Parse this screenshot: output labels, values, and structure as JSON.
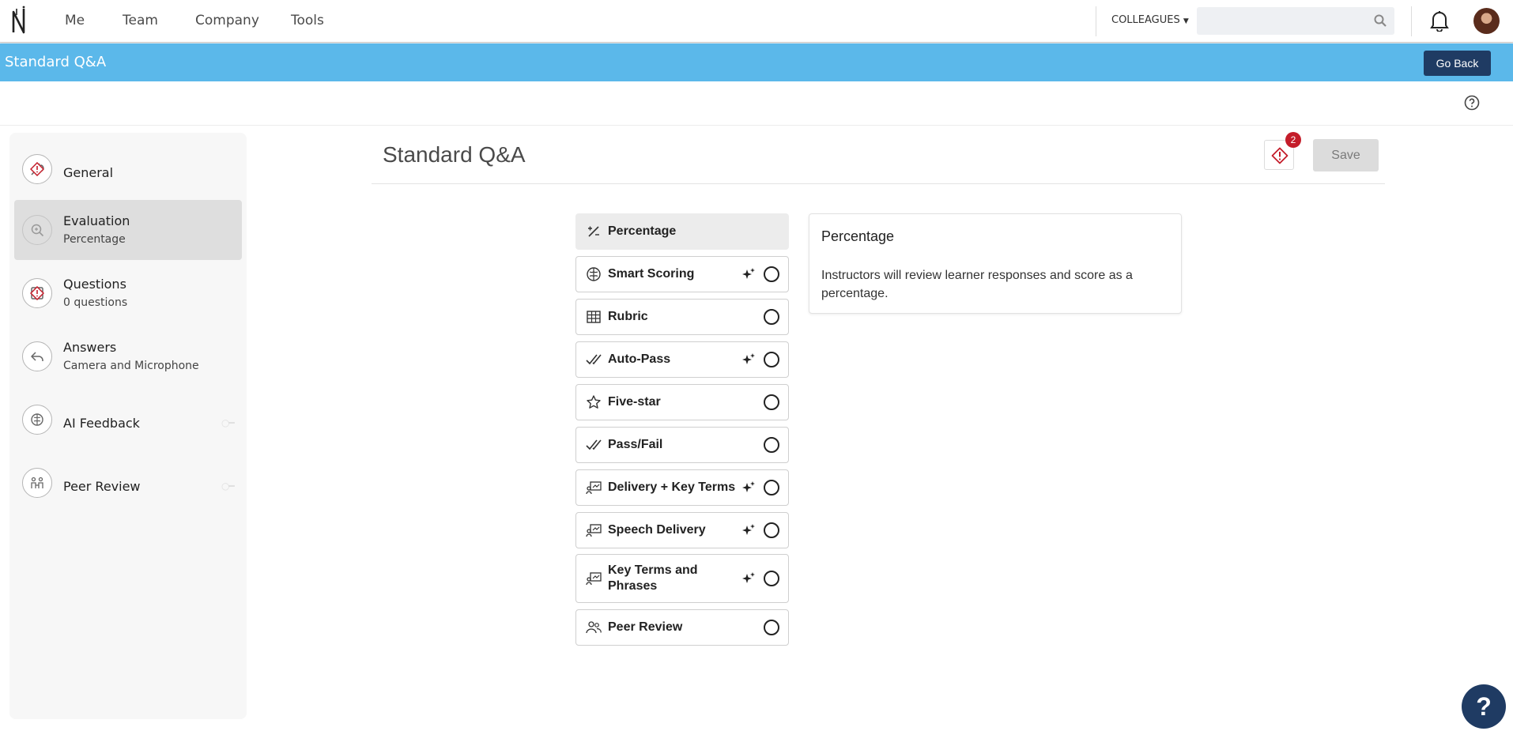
{
  "nav": {
    "links": [
      "Me",
      "Team",
      "Company",
      "Tools"
    ],
    "colleagues_label": "COLLEAGUES",
    "search_placeholder": ""
  },
  "banner": {
    "title": "Standard Q&A",
    "go_back_label": "Go Back"
  },
  "sidebar": {
    "items": [
      {
        "title": "General",
        "subtitle": "",
        "icon": "wrench-icon",
        "warning": true
      },
      {
        "title": "Evaluation",
        "subtitle": "Percentage",
        "icon": "magnify-icon",
        "warning": false,
        "active": true
      },
      {
        "title": "Questions",
        "subtitle": "0 questions",
        "icon": "question-doc-icon",
        "warning": true
      },
      {
        "title": "Answers",
        "subtitle": "Camera and Microphone",
        "icon": "reply-icon",
        "warning": false
      },
      {
        "title": "AI Feedback",
        "subtitle": "",
        "icon": "brain-icon",
        "warning": false
      },
      {
        "title": "Peer Review",
        "subtitle": "",
        "icon": "peers-icon",
        "warning": false
      }
    ]
  },
  "main": {
    "title": "Standard Q&A",
    "issues_count": "2",
    "save_label": "Save"
  },
  "options": [
    {
      "label": "Percentage",
      "icon": "percent-icon",
      "ai": false,
      "radio": false,
      "selected": true
    },
    {
      "label": "Smart Scoring",
      "icon": "brain-icon",
      "ai": true,
      "radio": true
    },
    {
      "label": "Rubric",
      "icon": "grid-icon",
      "ai": false,
      "radio": true
    },
    {
      "label": "Auto-Pass",
      "icon": "double-check-icon",
      "ai": true,
      "radio": true
    },
    {
      "label": "Five-star",
      "icon": "star-icon",
      "ai": false,
      "radio": true
    },
    {
      "label": "Pass/Fail",
      "icon": "double-check-icon",
      "ai": false,
      "radio": true
    },
    {
      "label": "Delivery + Key Terms",
      "icon": "presentation-icon",
      "ai": true,
      "radio": true
    },
    {
      "label": "Speech Delivery",
      "icon": "presentation-icon",
      "ai": true,
      "radio": true
    },
    {
      "label": "Key Terms and Phrases",
      "icon": "presentation-icon",
      "ai": true,
      "radio": true
    },
    {
      "label": "Peer Review",
      "icon": "people-icon",
      "ai": false,
      "radio": true
    }
  ],
  "description": {
    "title": "Percentage",
    "text": "Instructors will review learner responses and score as a percentage."
  },
  "help_fab": "?",
  "colors": {
    "banner": "#5bb8ea",
    "dark_button": "#1f3b63",
    "badge": "#c41d2a"
  }
}
